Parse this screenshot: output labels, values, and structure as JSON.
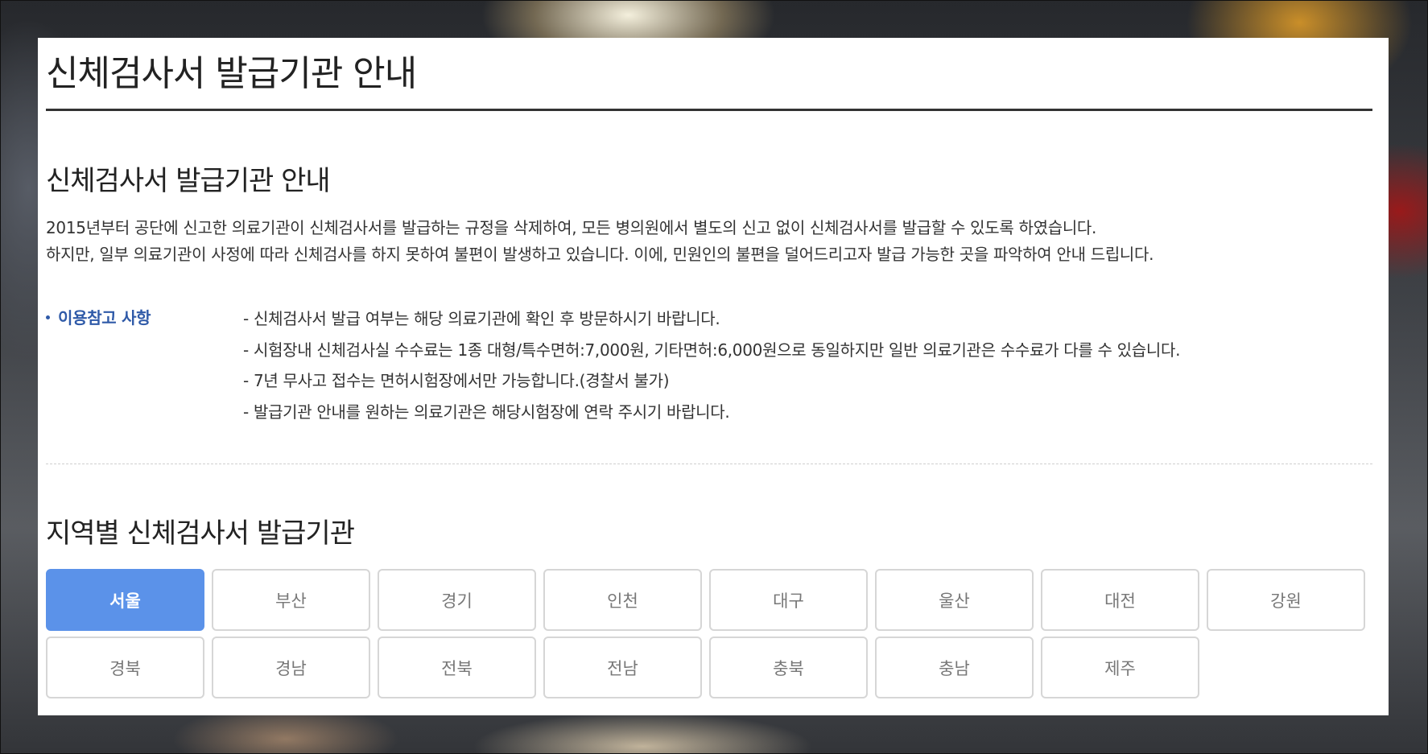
{
  "page": {
    "title": "신체검사서 발급기관 안내"
  },
  "intro_section": {
    "title": "신체검사서 발급기관 안내",
    "paragraphs": [
      "2015년부터 공단에 신고한 의료기관이 신체검사서를 발급하는 규정을 삭제하여, 모든 병의원에서 별도의 신고 없이 신체검사서를 발급할 수 있도록 하였습니다.",
      "하지만, 일부 의료기관이 사정에 따라 신체검사를 하지 못하여 불편이 발생하고 있습니다. 이에, 민원인의 불편을 덜어드리고자 발급 가능한 곳을 파악하여 안내 드립니다."
    ]
  },
  "notes": {
    "label": "이용참고 사항",
    "items": [
      "- 신체검사서 발급 여부는 해당 의료기관에 확인 후 방문하시기 바랍니다.",
      "- 시험장내 신체검사실 수수료는 1종 대형/특수면허:7,000원, 기타면허:6,000원으로 동일하지만 일반 의료기관은 수수료가 다를 수 있습니다.",
      "- 7년 무사고 접수는 면허시험장에서만 가능합니다.(경찰서 불가)",
      "- 발급기관 안내를 원하는 의료기관은 해당시험장에 연락 주시기 바랍니다."
    ]
  },
  "region_section": {
    "title": "지역별 신체검사서 발급기관",
    "selected": "서울",
    "regions": [
      "서울",
      "부산",
      "경기",
      "인천",
      "대구",
      "울산",
      "대전",
      "강원",
      "경북",
      "경남",
      "전북",
      "전남",
      "충북",
      "충남",
      "제주"
    ]
  },
  "colors": {
    "accent": "#5b92e9",
    "label_blue": "#2f5aa8",
    "panel_bg": "#ffffff"
  }
}
